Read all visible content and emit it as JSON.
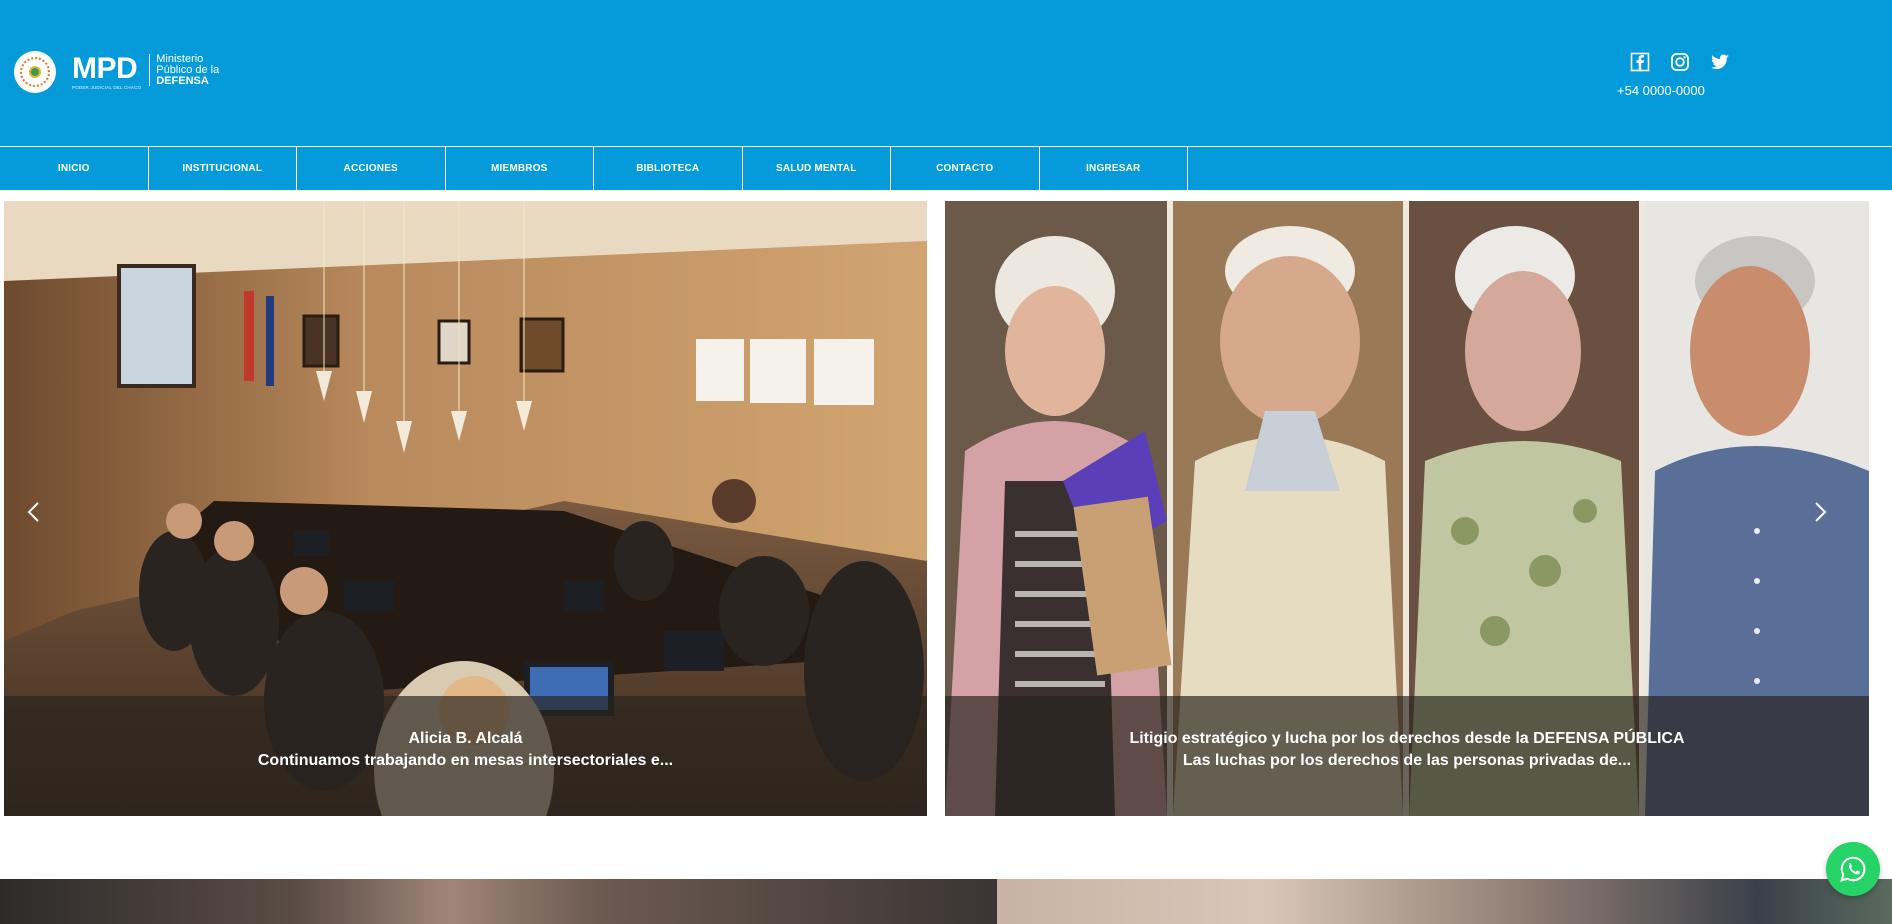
{
  "header": {
    "logo": {
      "abbrev": "MPD",
      "subline": "PODER JUDICIAL DEL CHACO",
      "name_line1": "Ministerio",
      "name_line2": "Público de la",
      "name_line3": "DEFENSA"
    },
    "social_icons": [
      "facebook-icon",
      "instagram-icon",
      "twitter-icon"
    ],
    "phone": "+54 0000-0000"
  },
  "nav": {
    "items": [
      {
        "label": "INICIO"
      },
      {
        "label": "INSTITUCIONAL"
      },
      {
        "label": "ACCIONES"
      },
      {
        "label": "MIEMBROS"
      },
      {
        "label": "BIBLIOTECA"
      },
      {
        "label": "SALUD MENTAL"
      },
      {
        "label": "CONTACTO"
      },
      {
        "label": "INGRESAR"
      }
    ]
  },
  "slides": [
    {
      "title": "Alicia B. Alcalá",
      "excerpt": "Continuamos trabajando en mesas intersectoriales e..."
    },
    {
      "title": "Litigio estratégico y lucha por los derechos desde la DEFENSA PÚBLICA",
      "excerpt": "Las luchas por los derechos de las personas privadas de..."
    }
  ],
  "controls": {
    "prev_icon": "chevron-left-icon",
    "next_icon": "chevron-right-icon",
    "whatsapp_icon": "whatsapp-icon"
  },
  "colors": {
    "brand_blue": "#059bdb",
    "whatsapp_green": "#25d366"
  }
}
